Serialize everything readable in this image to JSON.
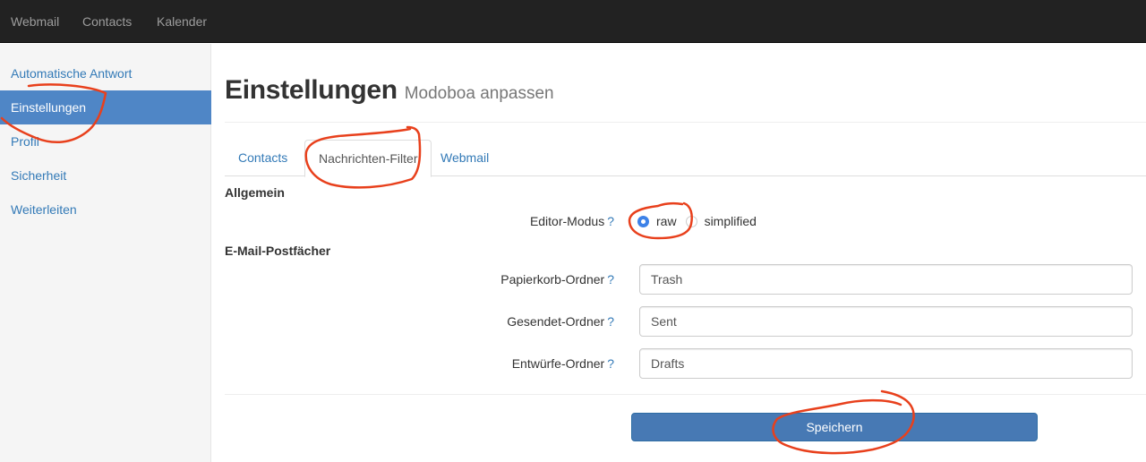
{
  "navbar": {
    "items": [
      {
        "label": "Webmail"
      },
      {
        "label": "Contacts"
      },
      {
        "label": "Kalender"
      }
    ]
  },
  "sidebar": {
    "items": [
      {
        "label": "Automatische Antwort",
        "active": false
      },
      {
        "label": "Einstellungen",
        "active": true
      },
      {
        "label": "Profil",
        "active": false
      },
      {
        "label": "Sicherheit",
        "active": false
      },
      {
        "label": "Weiterleiten",
        "active": false
      }
    ]
  },
  "header": {
    "title": "Einstellungen",
    "subtitle": "Modoboa anpassen"
  },
  "tabs": [
    {
      "label": "Contacts",
      "active": false
    },
    {
      "label": "Nachrichten-Filter",
      "active": true
    },
    {
      "label": "Webmail",
      "active": false
    }
  ],
  "sections": {
    "general": {
      "title": "Allgemein",
      "editor_mode": {
        "label": "Editor-Modus",
        "help": "?",
        "options": [
          {
            "label": "raw",
            "checked": true
          },
          {
            "label": "simplified",
            "checked": false
          }
        ]
      }
    },
    "mailboxes": {
      "title": "E-Mail-Postfächer",
      "fields": [
        {
          "label": "Papierkorb-Ordner",
          "help": "?",
          "value": "Trash"
        },
        {
          "label": "Gesendet-Ordner",
          "help": "?",
          "value": "Sent"
        },
        {
          "label": "Entwürfe-Ordner",
          "help": "?",
          "value": "Drafts"
        }
      ]
    }
  },
  "actions": {
    "save_label": "Speichern"
  },
  "colors": {
    "navbar_bg": "#222222",
    "link": "#337ab7",
    "active_sidebar": "#4f86c6",
    "primary_button": "#4779b4",
    "annotation": "#e8401c"
  }
}
